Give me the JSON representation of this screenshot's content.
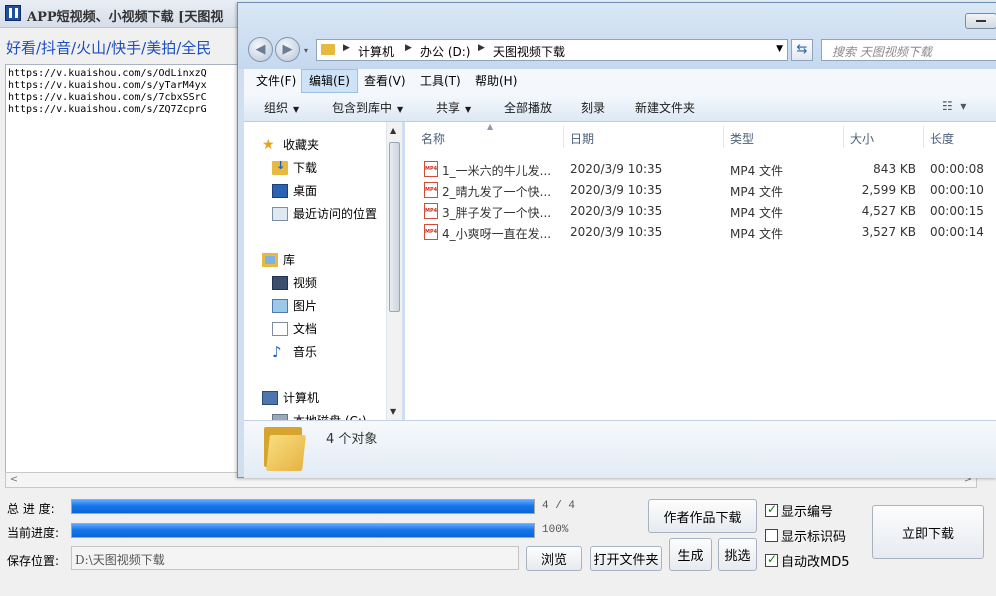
{
  "app": {
    "title": "APP短视频、小视频下载 [天图视",
    "platforms": "好看/抖音/火山/快手/美拍/全民",
    "urls": [
      "https://v.kuaishou.com/s/OdLinxzQ",
      "https://v.kuaishou.com/s/yTarM4yx",
      "https://v.kuaishou.com/s/7cbxSSrC",
      "https://v.kuaishou.com/s/ZQ7ZcprG"
    ],
    "progress": {
      "total_label": "总 进 度:",
      "total_fraction": 1.0,
      "total_text": "4 / 4",
      "current_label": "当前进度:",
      "current_fraction": 1.0,
      "current_text": "100%"
    },
    "save_label": "保存位置:",
    "save_path": "D:\\天图视频下载",
    "buttons": {
      "browse": "浏览",
      "open_folder": "打开文件夹",
      "author_download": "作者作品下载",
      "generate": "生成",
      "pick": "挑选",
      "download_now": "立即下载"
    },
    "checkboxes": [
      {
        "label": "显示编号",
        "checked": true
      },
      {
        "label": "显示标识码",
        "checked": false
      },
      {
        "label": "自动改MD5",
        "checked": true
      }
    ]
  },
  "explorer": {
    "breadcrumb": [
      "计算机",
      "办公 (D:)",
      "天图视频下载"
    ],
    "search_placeholder": "搜索 天图视频下载",
    "menu": [
      {
        "label": "文件(F)",
        "active": false
      },
      {
        "label": "编辑(E)",
        "active": true
      },
      {
        "label": "查看(V)",
        "active": false
      },
      {
        "label": "工具(T)",
        "active": false
      },
      {
        "label": "帮助(H)",
        "active": false
      }
    ],
    "toolbar": {
      "organize": "组织",
      "include_library": "包含到库中",
      "share": "共享",
      "play_all": "全部播放",
      "burn": "刻录",
      "new_folder": "新建文件夹"
    },
    "nav": {
      "favorites": "收藏夹",
      "downloads": "下载",
      "desktop": "桌面",
      "recent": "最近访问的位置",
      "libraries": "库",
      "videos": "视频",
      "pictures": "图片",
      "documents": "文档",
      "music": "音乐",
      "computer": "计算机",
      "local_disk": "本地磁盘 (C:)"
    },
    "columns": {
      "name": "名称",
      "date": "日期",
      "type": "类型",
      "size": "大小",
      "length": "长度"
    },
    "files": [
      {
        "name": "1_一米六的牛儿发...",
        "date": "2020/3/9 10:35",
        "type": "MP4 文件",
        "size": "843 KB",
        "length": "00:00:08"
      },
      {
        "name": "2_晴九发了一个快...",
        "date": "2020/3/9 10:35",
        "type": "MP4 文件",
        "size": "2,599 KB",
        "length": "00:00:10"
      },
      {
        "name": "3_胖子发了一个快...",
        "date": "2020/3/9 10:35",
        "type": "MP4 文件",
        "size": "4,527 KB",
        "length": "00:00:15"
      },
      {
        "name": "4_小爽呀一直在发...",
        "date": "2020/3/9 10:35",
        "type": "MP4 文件",
        "size": "3,527 KB",
        "length": "00:00:14"
      }
    ],
    "file_icon_text": "MP4",
    "object_count": "4 个对象"
  }
}
